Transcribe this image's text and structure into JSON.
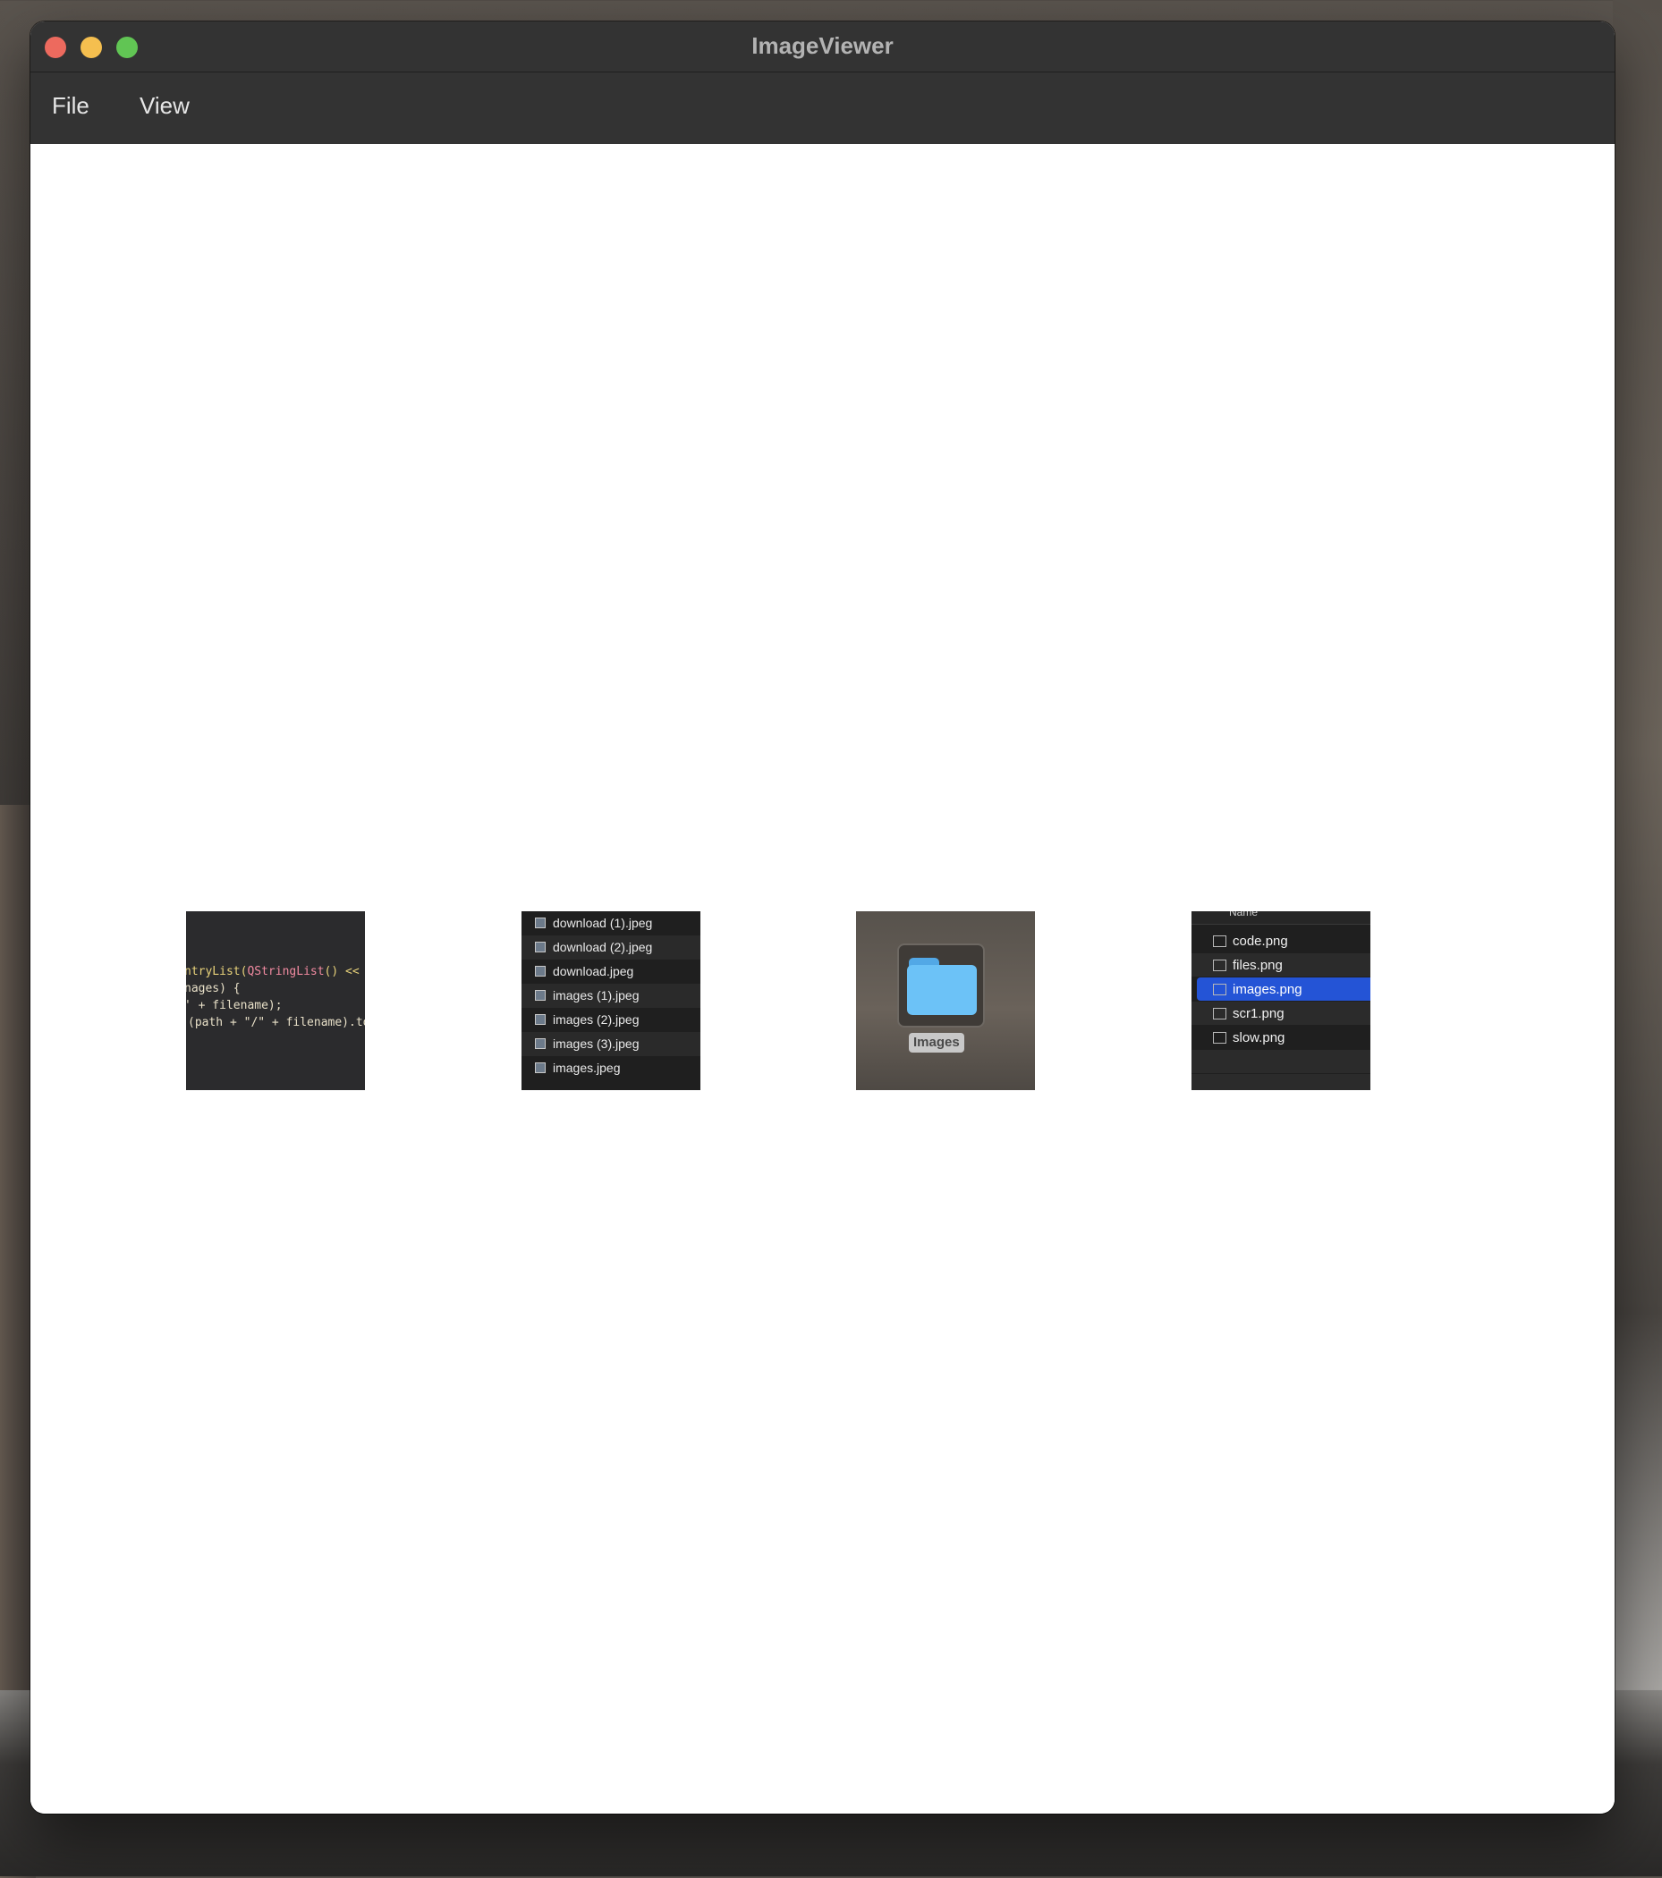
{
  "window": {
    "title": "ImageViewer"
  },
  "menu": {
    "file": "File",
    "view": "View"
  },
  "thumbnails": {
    "code": {
      "lines": [
        [
          "ntryList(",
          "QStringList",
          "() << \"*."
        ],
        [
          "nages) {"
        ],
        [
          "' + filename);"
        ],
        [
          "(path + \"/\" + filename).toSt"
        ]
      ]
    },
    "file_list": {
      "items": [
        "download (1).jpeg",
        "download (2).jpeg",
        "download.jpeg",
        "images (1).jpeg",
        "images (2).jpeg",
        "images (3).jpeg",
        "images.jpeg"
      ]
    },
    "folder": {
      "label": "Images"
    },
    "finder_list": {
      "column_header": "Name",
      "items": [
        "code.png",
        "files.png",
        "images.png",
        "scr1.png",
        "slow.png"
      ],
      "selected": "images.png"
    }
  },
  "colors": {
    "selection": "#2454d6",
    "folder": "#6cc2f7",
    "traffic_close": "#ed6a5e",
    "traffic_minimize": "#f5bf4f",
    "traffic_zoom": "#61c554"
  }
}
